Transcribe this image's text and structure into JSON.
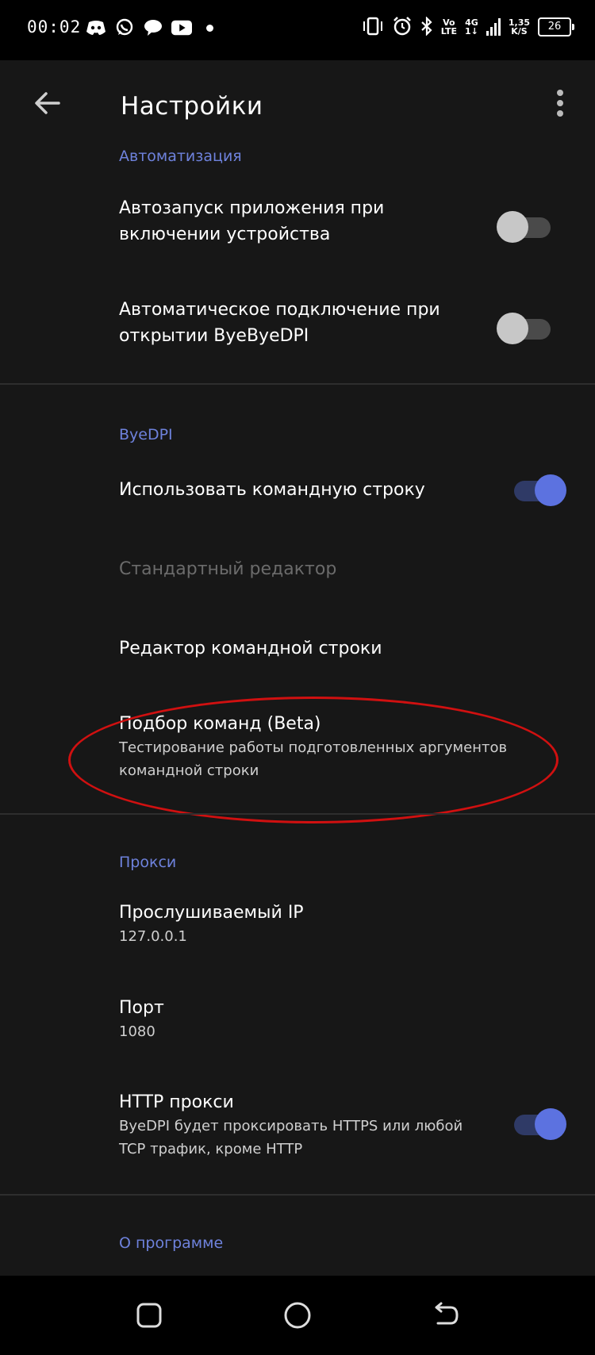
{
  "status_bar": {
    "time": "00:02",
    "network_top": "Vo",
    "network_bottom": "LTE",
    "gen_top": "4G",
    "gen_bottom": "1↓",
    "speed_value": "1,35",
    "speed_unit": "K/S",
    "battery": "26"
  },
  "toolbar": {
    "title": "Настройки",
    "back_icon": "arrow-left-icon",
    "menu_icon": "more-vert-icon"
  },
  "sections": {
    "automation": {
      "header": "Автоматизация",
      "autostart_title": "Автозапуск приложения при включении устройства",
      "autostart_enabled": false,
      "autoconnect_title": "Автоматическое подключение при открытии ByeByeDPI",
      "autoconnect_enabled": false
    },
    "byedpi": {
      "header": "ByeDPI",
      "use_cmd_title": "Использовать командную строку",
      "use_cmd_enabled": true,
      "standard_editor_title": "Стандартный редактор",
      "cmd_editor_title": "Редактор командной строки",
      "cmd_picker_title": "Подбор команд (Beta)",
      "cmd_picker_summary": "Тестирование работы подготовленных аргументов командной строки"
    },
    "proxy": {
      "header": "Прокси",
      "ip_title": "Прослушиваемый IP",
      "ip_value": "127.0.0.1",
      "port_title": "Порт",
      "port_value": "1080",
      "http_title": "HTTP прокси",
      "http_summary": "ByeDPI будет проксировать HTTPS или любой TCP трафик, кроме HTTP",
      "http_enabled": true
    },
    "about": {
      "header": "О программе"
    }
  },
  "colors": {
    "accent": "#5c72e0",
    "background": "#171717",
    "highlight": "#d01010"
  }
}
